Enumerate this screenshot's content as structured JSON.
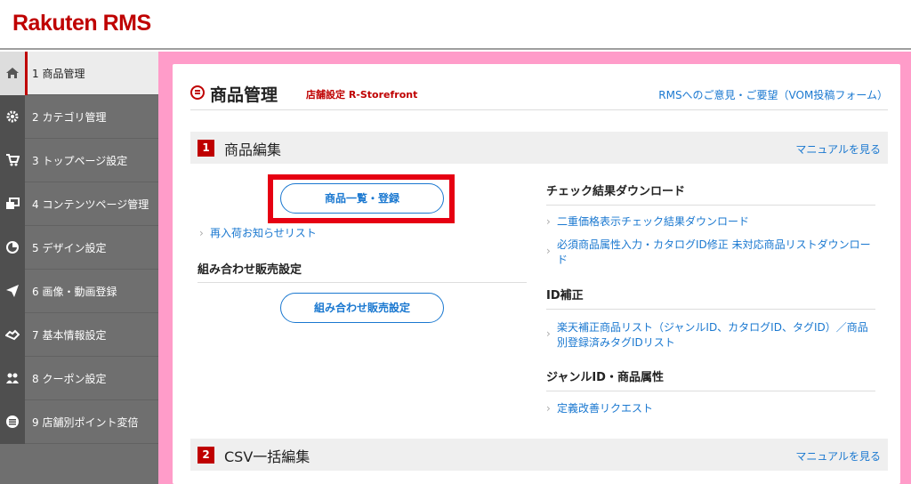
{
  "brand": {
    "logo": "Rakuten RMS"
  },
  "sidebar": {
    "items": [
      {
        "label": "1 商品管理",
        "icon": "home-icon"
      },
      {
        "label": "2 カテゴリ管理",
        "icon": "gear-icon"
      },
      {
        "label": "3 トップページ設定",
        "icon": "cart-icon"
      },
      {
        "label": "4 コンテンツページ管理",
        "icon": "pages-icon"
      },
      {
        "label": "5 デザイン設定",
        "icon": "pie-chart-icon"
      },
      {
        "label": "6 画像・動画登録",
        "icon": "paper-plane-icon"
      },
      {
        "label": "7 基本情報設定",
        "icon": "handshake-icon"
      },
      {
        "label": "8 クーポン設定",
        "icon": "users-icon"
      },
      {
        "label": "9 店舗別ポイント変倍",
        "icon": "list-circle-icon"
      }
    ]
  },
  "main": {
    "title": "商品管理",
    "subtitle": "店舗設定 R-Storefront",
    "feedback_link": "RMSへのご意見・ご要望（VOM投稿フォーム）",
    "section1": {
      "num": "1",
      "title": "商品編集",
      "manual": "マニュアルを見る"
    },
    "section2": {
      "num": "2",
      "title": "CSV一括編集",
      "manual": "マニュアルを見る"
    },
    "left": {
      "btn_list": "商品一覧・登録",
      "link_restock": "再入荷お知らせリスト",
      "head_combo": "組み合わせ販売設定",
      "btn_combo": "組み合わせ販売設定"
    },
    "right": {
      "head_check": "チェック結果ダウンロード",
      "link_double_price": "二重価格表示チェック結果ダウンロード",
      "link_required": "必須商品属性入力・カタログID修正 未対応商品リストダウンロード",
      "head_id": "ID補正",
      "link_rakuten_fix": "楽天補正商品リスト（ジャンルID、カタログID、タグID）／商品別登録済みタグIDリスト",
      "head_genre": "ジャンルID・商品属性",
      "link_request": "定義改善リクエスト"
    }
  }
}
